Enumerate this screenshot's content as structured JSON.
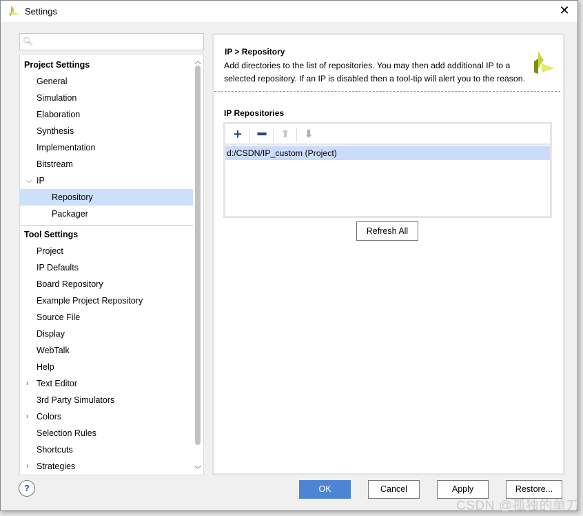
{
  "window": {
    "title": "Settings",
    "close_icon": "close-icon"
  },
  "search": {
    "placeholder": ""
  },
  "tree": {
    "sections": [
      {
        "label": "Project Settings",
        "items": [
          {
            "label": "General"
          },
          {
            "label": "Simulation"
          },
          {
            "label": "Elaboration"
          },
          {
            "label": "Synthesis"
          },
          {
            "label": "Implementation"
          },
          {
            "label": "Bitstream"
          },
          {
            "label": "IP",
            "expanded": true,
            "children": [
              {
                "label": "Repository",
                "selected": true
              },
              {
                "label": "Packager"
              }
            ]
          }
        ]
      },
      {
        "label": "Tool Settings",
        "items": [
          {
            "label": "Project"
          },
          {
            "label": "IP Defaults"
          },
          {
            "label": "Board Repository"
          },
          {
            "label": "Example Project Repository"
          },
          {
            "label": "Source File"
          },
          {
            "label": "Display"
          },
          {
            "label": "WebTalk"
          },
          {
            "label": "Help"
          },
          {
            "label": "Text Editor",
            "collapsed": true
          },
          {
            "label": "3rd Party Simulators"
          },
          {
            "label": "Colors",
            "collapsed": true
          },
          {
            "label": "Selection Rules"
          },
          {
            "label": "Shortcuts"
          },
          {
            "label": "Strategies",
            "collapsed": true
          }
        ]
      }
    ]
  },
  "panel": {
    "title": "IP > Repository",
    "description": "Add directories to the list of repositories. You may then add additional IP to a selected repository. If an IP is disabled then a tool-tip will alert you to the reason.",
    "repositories_label": "IP Repositories",
    "repositories": [
      "d:/CSDN/IP_custom (Project)"
    ],
    "refresh_label": "Refresh All"
  },
  "buttons": {
    "help": "?",
    "ok": "OK",
    "cancel": "Cancel",
    "apply": "Apply",
    "restore": "Restore..."
  },
  "colors": {
    "accent": "#4e84d4",
    "selection": "#cce0fc",
    "logo": "#c8d43c"
  },
  "watermark": "CSDN @孤独的单刀"
}
